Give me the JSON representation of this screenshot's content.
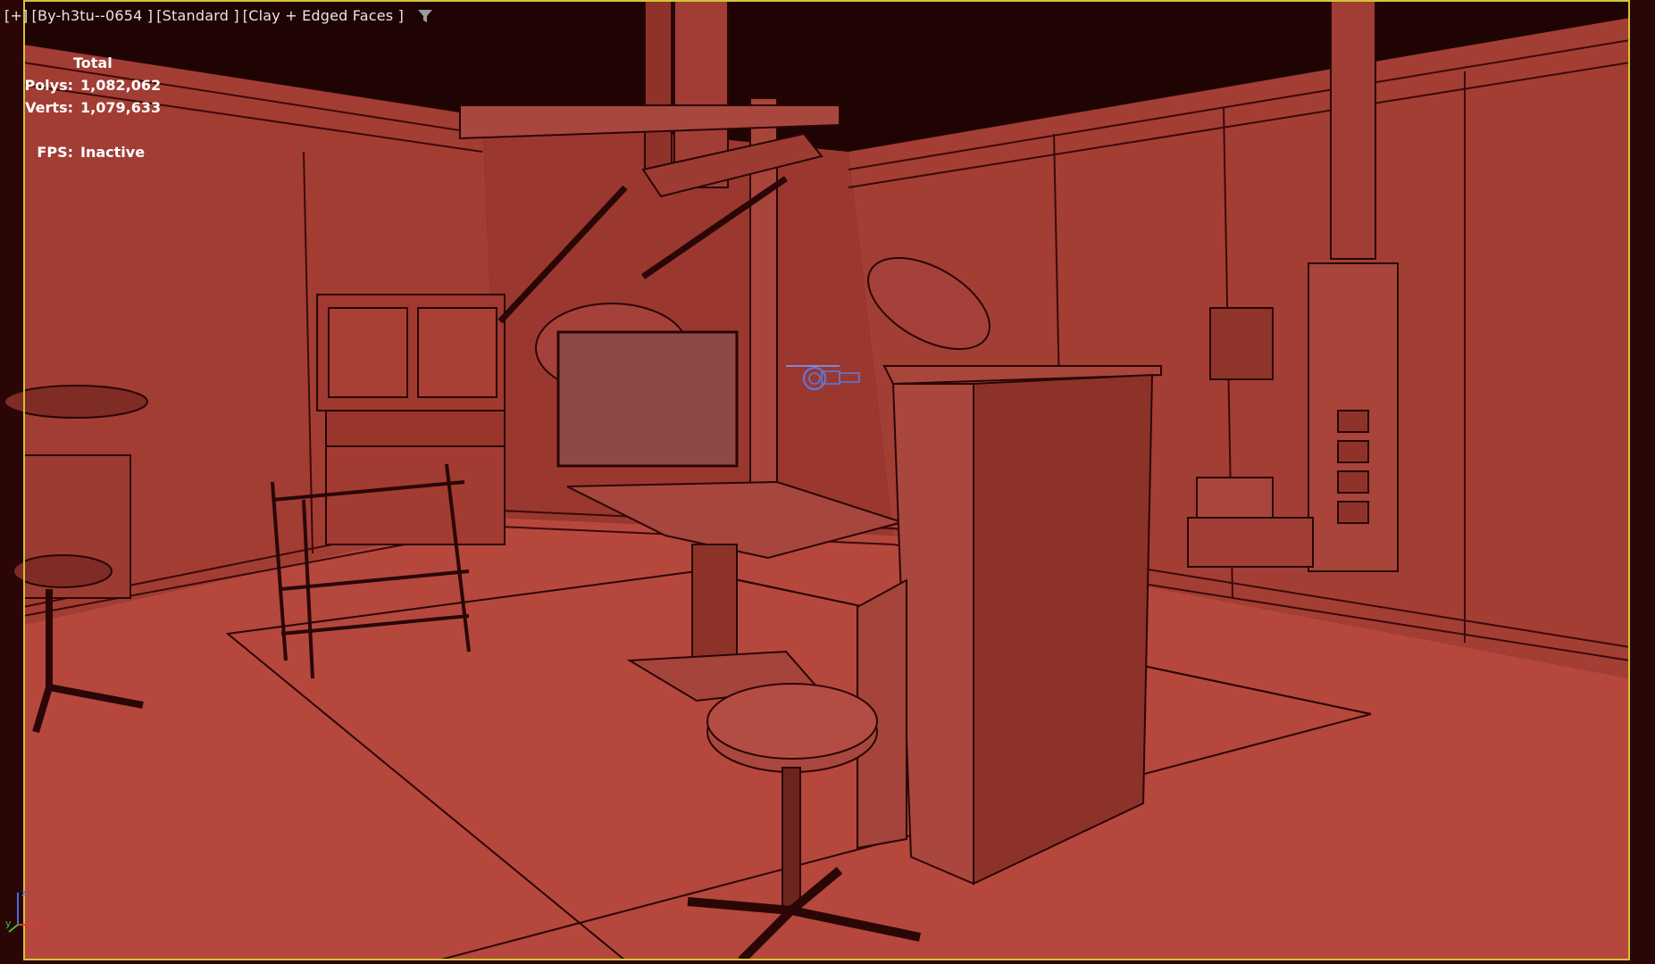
{
  "viewport": {
    "label_segments": [
      {
        "name": "menu",
        "text": "[+]"
      },
      {
        "name": "camera",
        "text": "[By-h3tu--0654 ]"
      },
      {
        "name": "shading-preset",
        "text": "[Standard ]"
      },
      {
        "name": "display-mode",
        "text": "[Clay + Edged Faces ]"
      }
    ],
    "filter_icon": "filter-icon"
  },
  "stats": {
    "header": "Total",
    "polys_label": "Polys:",
    "polys_value": "1,082,062",
    "verts_label": "Verts:",
    "verts_value": "1,079,633",
    "fps_label": "FPS:",
    "fps_value": "Inactive"
  },
  "axis": {
    "z_label": "z",
    "x_label": "x",
    "y_label": "y"
  },
  "colors": {
    "frame_border": "#d4c23a",
    "clay_wall": "#b0443a",
    "clay_floor": "#b5473d",
    "ceiling": "#200404",
    "edge_line": "#2a0606",
    "gizmo": "#5a7ae6",
    "label_text": "#e6e6e6"
  }
}
